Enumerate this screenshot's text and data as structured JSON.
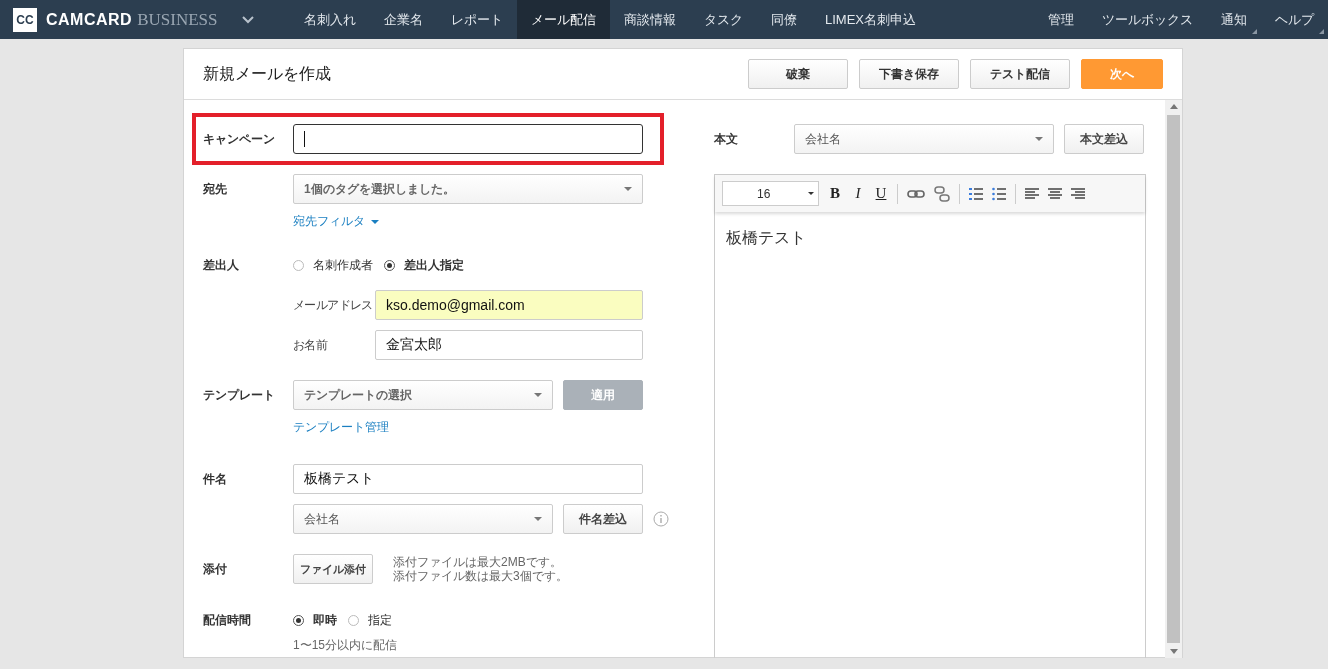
{
  "nav": {
    "logo_mark": "CC",
    "brand": "CAMCARD",
    "brand_suffix": "BUSINESS",
    "tabs": [
      {
        "label": "名刺入れ",
        "selected": false
      },
      {
        "label": "企業名",
        "selected": false
      },
      {
        "label": "レポート",
        "selected": false
      },
      {
        "label": "メール配信",
        "selected": true
      },
      {
        "label": "商談情報",
        "selected": false
      },
      {
        "label": "タスク",
        "selected": false
      },
      {
        "label": "同僚",
        "selected": false
      },
      {
        "label": "LIMEX名刺申込",
        "selected": false
      }
    ],
    "right_items": [
      {
        "label": "管理",
        "dropdown": false
      },
      {
        "label": "ツールボックス",
        "dropdown": false
      },
      {
        "label": "通知",
        "dropdown": true
      },
      {
        "label": "ヘルプ",
        "dropdown": true
      }
    ]
  },
  "page_title": "新規メールを作成",
  "header_buttons": [
    {
      "label": "破棄",
      "kind": "default"
    },
    {
      "label": "下書き保存",
      "kind": "default"
    },
    {
      "label": "テスト配信",
      "kind": "default"
    },
    {
      "label": "次へ",
      "kind": "primary"
    }
  ],
  "campaign": {
    "label": "キャンペーン",
    "highlighted": true
  },
  "recipients": {
    "label": "宛先",
    "value": "1個のタグを選択しました。",
    "filter_link": "宛先フィルタ"
  },
  "sender": {
    "label": "差出人",
    "options": [
      {
        "label": "名刺作成者",
        "selected": false
      },
      {
        "label": "差出人指定",
        "selected": true
      }
    ],
    "email": {
      "label": "メールアドレス",
      "value": "kso.demo@gmail.com"
    },
    "name": {
      "label": "お名前",
      "value": "金宮太郎"
    }
  },
  "template": {
    "label": "テンプレート",
    "value": "テンプレートの選択",
    "apply_button": {
      "label": "適用",
      "disabled": true
    },
    "manage_link": "テンプレート管理"
  },
  "subject": {
    "label": "件名",
    "value": "板橋テスト",
    "merge_select": "会社名",
    "merge_button": "件名差込"
  },
  "attachment": {
    "label": "添付",
    "button": "ファイル添付",
    "notes": [
      "添付ファイルは最大2MBです。",
      "添付ファイル数は最大3個です。"
    ]
  },
  "delivery": {
    "label": "配信時間",
    "options": [
      {
        "label": "即時",
        "selected": true
      },
      {
        "label": "指定",
        "selected": false
      }
    ],
    "note": "1〜15分以内に配信"
  },
  "body": {
    "label": "本文",
    "merge_select": "会社名",
    "merge_button": "本文差込",
    "font_size": "16",
    "bold": "B",
    "italic": "I",
    "underline": "U",
    "content": "板橋テスト"
  }
}
